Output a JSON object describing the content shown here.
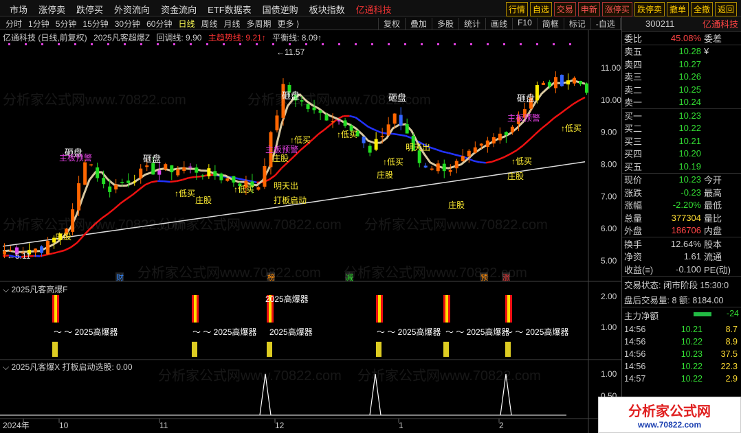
{
  "menu": [
    "市场",
    "涨停卖",
    "跌停买",
    "外资流向",
    "资金流向",
    "ETF数据表",
    "国债逆购",
    "板块指数",
    "亿通科技"
  ],
  "tools": [
    "行情",
    "自选",
    "交易",
    "申新",
    "涨停买",
    "跌停卖",
    "撤单",
    "全撤",
    "返回"
  ],
  "periods": [
    "分时",
    "1分钟",
    "5分钟",
    "15分钟",
    "30分钟",
    "60分钟",
    "日线",
    "周线",
    "月线",
    "多周期",
    "更多 ⟩"
  ],
  "active_period": "日线",
  "right_tools": [
    "复权",
    "叠加",
    "多股",
    "统计",
    "画线",
    "F10",
    "简框",
    "标记",
    "-自选",
    "返回"
  ],
  "main_title": {
    "stock": "亿通科技 (日线,前复权)",
    "indicator": "2025凡客超爆Z",
    "line1": "回调线: 9.90",
    "line2": "主趋势线: 9.21↑",
    "line3": "平衡线: 8.09↑"
  },
  "panel2_title": "2025凡客高爆F",
  "panel3_title": "2025凡客爆X  打板启动选股: 0.00",
  "price_axis": [
    "11.00",
    "10.00",
    "9.00",
    "8.00",
    "7.00",
    "6.00",
    "5.00"
  ],
  "panel2_axis": [
    "2.00",
    "1.00"
  ],
  "panel3_axis": [
    "1.00",
    "0.50"
  ],
  "date_axis": [
    "2024年",
    "10",
    "11",
    "12",
    "1",
    "2"
  ],
  "annotations": {
    "hi": "←11.57",
    "lo": "←5.11",
    "zapan": "砸盘",
    "dimai": "↑低买",
    "zhuanggu": "庄股",
    "mingtian": "明天出",
    "qidong": "打板启动",
    "yujing": "主板预警",
    "gaobao": "2025高爆器",
    "gaobao_label": "～ ～ 2025高爆器"
  },
  "event_tags": [
    "财",
    "榜",
    "减",
    "预",
    "涨"
  ],
  "quote": {
    "code": "300211",
    "name": "亿通科技",
    "weibi_label": "委比",
    "weibi": "45.08%",
    "weicha_label": "委差",
    "asks": [
      {
        "label": "卖五",
        "price": "10.28"
      },
      {
        "label": "卖四",
        "price": "10.27"
      },
      {
        "label": "卖三",
        "price": "10.26"
      },
      {
        "label": "卖二",
        "price": "10.25"
      },
      {
        "label": "卖一",
        "price": "10.24"
      }
    ],
    "bids": [
      {
        "label": "买一",
        "price": "10.23"
      },
      {
        "label": "买二",
        "price": "10.22"
      },
      {
        "label": "买三",
        "price": "10.21"
      },
      {
        "label": "买四",
        "price": "10.20"
      },
      {
        "label": "买五",
        "price": "10.19"
      }
    ],
    "stats": [
      {
        "l": "现价",
        "v": "10.23",
        "c": "green",
        "r": "今开"
      },
      {
        "l": "涨跌",
        "v": "-0.23",
        "c": "green",
        "r": "最高"
      },
      {
        "l": "涨幅",
        "v": "-2.20%",
        "c": "green",
        "r": "最低"
      },
      {
        "l": "总量",
        "v": "377304",
        "c": "yellow",
        "r": "量比"
      },
      {
        "l": "外盘",
        "v": "186706",
        "c": "red",
        "r": "内盘"
      }
    ],
    "stats2": [
      {
        "l": "换手",
        "v": "12.64%",
        "r": "股本"
      },
      {
        "l": "净资",
        "v": "1.61",
        "r": "流通"
      },
      {
        "l": "收益(≡)",
        "v": "-0.100",
        "r": "PE(动)"
      }
    ],
    "trade_status": "交易状态: 闭市阶段 15:30:0",
    "after_hours": "盘后交易量: 8  额: 8184.00",
    "main_net": "主力净额",
    "main_net_val": "-24",
    "ticks": [
      {
        "t": "14:56",
        "p": "10.21",
        "v": "8.7"
      },
      {
        "t": "14:56",
        "p": "10.22",
        "v": "8.9"
      },
      {
        "t": "14:56",
        "p": "10.23",
        "v": "37.5"
      },
      {
        "t": "14:56",
        "p": "10.22",
        "v": "22.3"
      },
      {
        "t": "14:57",
        "p": "10.22",
        "v": "2.9"
      }
    ]
  },
  "logo": {
    "line1": "分析家公式网",
    "line2": "www.70822.com"
  },
  "watermark": "分析家公式网www.70822.com"
}
